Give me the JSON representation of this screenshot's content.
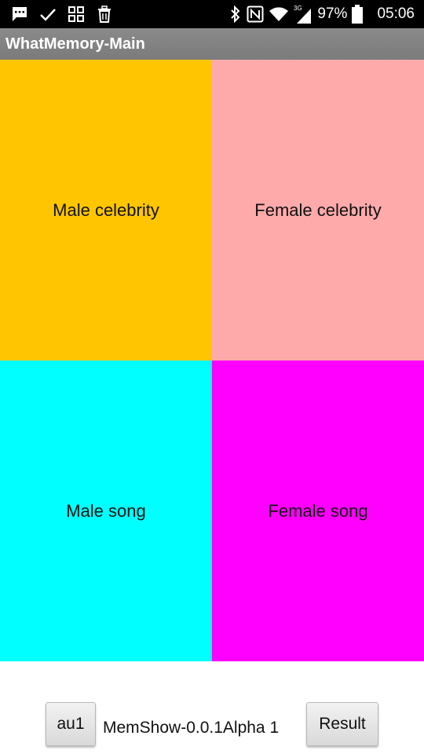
{
  "status_bar": {
    "icons": [
      "message-icon",
      "check-icon",
      "apps-icon",
      "trash-icon",
      "bluetooth-icon",
      "nfc-icon",
      "wifi-icon",
      "signal-3g-icon",
      "battery-icon"
    ],
    "network_label": "3G",
    "battery": "97%",
    "time": "05:06"
  },
  "app": {
    "title": "WhatMemory-Main"
  },
  "tiles": [
    {
      "label": "Male celebrity",
      "color": "#FFC600"
    },
    {
      "label": "Female celebrity",
      "color": "#FFAAAA"
    },
    {
      "label": "Male song",
      "color": "#00FFFF"
    },
    {
      "label": "Female song",
      "color": "#FF00FF"
    }
  ],
  "bottom": {
    "left_button": "au1",
    "version_text": "MemShow-0.0.1Alpha 1",
    "right_button": "Result"
  }
}
